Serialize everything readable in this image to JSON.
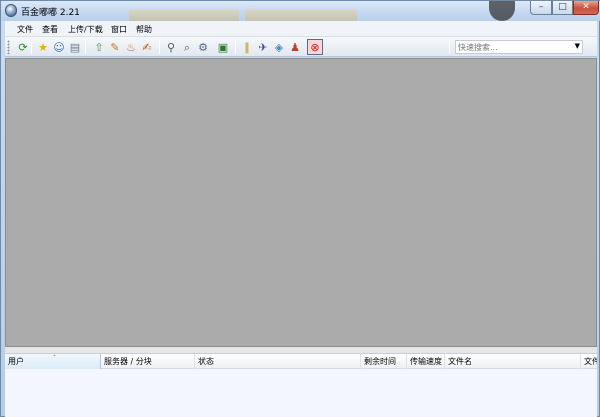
{
  "window": {
    "title": "百金嘟嘟 2.21",
    "controls": {
      "minimize": "–",
      "maximize": "□",
      "close": "✕"
    }
  },
  "menu": {
    "items": [
      "文件",
      "查看",
      "上传/下载",
      "窗口",
      "帮助"
    ]
  },
  "toolbar": {
    "buttons": [
      {
        "name": "refresh-icon",
        "glyph": "⟳",
        "color": "#2e8b2e"
      },
      {
        "name": "favorite-star-icon",
        "glyph": "★",
        "color": "#e8b000"
      },
      {
        "name": "users-icon",
        "glyph": "☺",
        "color": "#3a6fb0"
      },
      {
        "name": "document-icon",
        "glyph": "▤",
        "color": "#6a7c92"
      },
      {
        "name": "upload-user-icon",
        "glyph": "⇧",
        "color": "#3b9a3b"
      },
      {
        "name": "edit-pencil-icon",
        "glyph": "✎",
        "color": "#c07a10"
      },
      {
        "name": "flame-icon",
        "glyph": "♨",
        "color": "#d2691e"
      },
      {
        "name": "write-icon",
        "glyph": "✍",
        "color": "#b05a10"
      },
      {
        "name": "search-magnifier-icon",
        "glyph": "⚲",
        "color": "#555555"
      },
      {
        "name": "find-file-icon",
        "glyph": "⌕",
        "color": "#6b5a2a"
      },
      {
        "name": "network-icon",
        "glyph": "⚙",
        "color": "#4a6a8a"
      },
      {
        "name": "monitor-icon",
        "glyph": "▣",
        "color": "#2b7a2b"
      },
      {
        "name": "pause-icon",
        "glyph": "∥",
        "color": "#c08a10"
      },
      {
        "name": "pin-icon",
        "glyph": "✈",
        "color": "#3a4f8a"
      },
      {
        "name": "save-disk-icon",
        "glyph": "◈",
        "color": "#4a8ab8"
      },
      {
        "name": "people-icon",
        "glyph": "♟",
        "color": "#c0402a"
      },
      {
        "name": "stop-icon",
        "glyph": "⊗",
        "color": "#c62020"
      }
    ],
    "search": {
      "label": "快速搜索...",
      "value": "",
      "dropdown_glyph": "▼"
    }
  },
  "transfer_list": {
    "columns": [
      "用户",
      "服务器 / 分块",
      "状态",
      "剩余时间",
      "传输速度",
      "文件名",
      "文件"
    ],
    "sort_glyph": "ˆ",
    "rows": []
  }
}
